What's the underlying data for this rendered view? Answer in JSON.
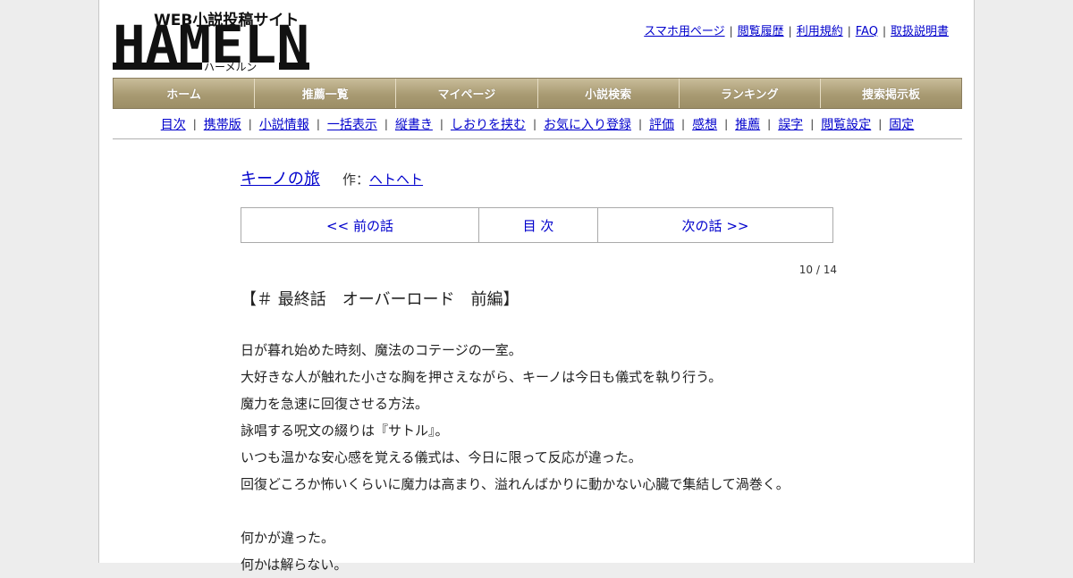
{
  "site": {
    "logo_tagline": "WEB小説投稿サイト",
    "logo_name": "HAMELN",
    "logo_kana": "ハーメルン"
  },
  "top_links": [
    "スマホ用ページ",
    "閲覧履歴",
    "利用規約",
    "FAQ",
    "取扱説明書"
  ],
  "main_nav": [
    "ホーム",
    "推薦一覧",
    "マイページ",
    "小説検索",
    "ランキング",
    "捜索掲示板"
  ],
  "sub_nav": [
    "目次",
    "携帯版",
    "小説情報",
    "一括表示",
    "縦書き",
    "しおりを挟む",
    "お気に入り登録",
    "評価",
    "感想",
    "推薦",
    "誤字",
    "閲覧設定",
    "固定"
  ],
  "novel": {
    "title": "キーノの旅",
    "author_label": "作：",
    "author": "ヘトヘト"
  },
  "pager": {
    "prev": "<< 前の話",
    "toc": "目 次",
    "next": "次の話 >>"
  },
  "page_count": "10 / 14",
  "chapter_title": "【＃ 最終話　オーバーロード　前編】",
  "paragraphs": [
    "日が暮れ始めた時刻、魔法のコテージの一室。",
    "大好きな人が触れた小さな胸を押さえながら、キーノは今日も儀式を執り行う。",
    "魔力を急速に回復させる方法。",
    "詠唱する呪文の綴りは『サトル』。",
    "いつも温かな安心感を覚える儀式は、今日に限って反応が違った。",
    "回復どころか怖いくらいに魔力は高まり、溢れんばかりに動かない心臓で集結して渦巻く。",
    "",
    "何かが違った。",
    "何かは解らない。"
  ]
}
